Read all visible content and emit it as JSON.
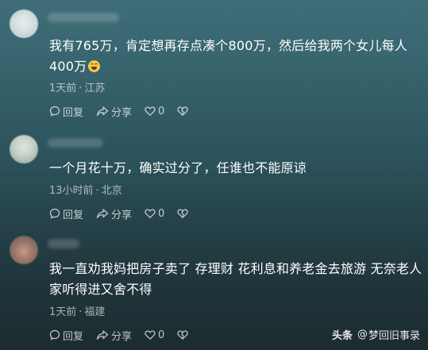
{
  "comments": [
    {
      "text": "我有765万，肯定想再存点凑个800万，然后给我两个女儿每人400万",
      "time": "1天前",
      "location": "江苏",
      "reply_label": "回复",
      "share_label": "分享",
      "likes": "0",
      "emoji_icon": "laughing-tears-emoji-icon"
    },
    {
      "text": "一个月花十万，确实过分了，任谁也不能原谅",
      "time": "13小时前",
      "location": "北京",
      "reply_label": "回复",
      "share_label": "分享",
      "likes": "0"
    },
    {
      "text": "我一直劝我妈把房子卖了 存理财 花利息和养老金去旅游 无奈老人家听得进又舍不得",
      "time": "1天前",
      "location": "福建",
      "reply_label": "回复",
      "share_label": "分享",
      "likes": "0"
    }
  ],
  "separator": "·",
  "watermark": {
    "brand": "头条",
    "author": "梦回旧事录"
  },
  "colors": {
    "background_top": "#3f6e78",
    "background_bottom": "#1b2b2f",
    "text": "#ffffff",
    "meta_text": "rgba(255,255,255,0.62)"
  }
}
